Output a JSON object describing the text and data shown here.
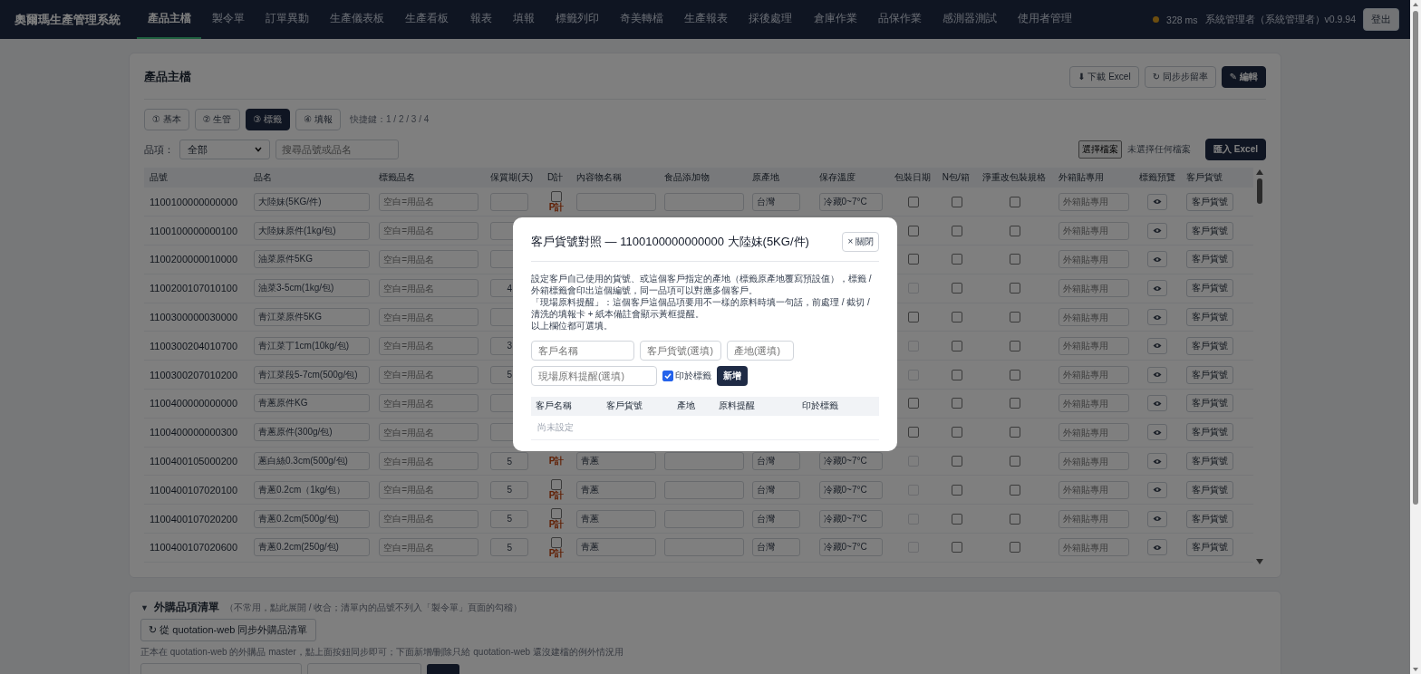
{
  "nav": {
    "brand": "奧爾瑪生產管理系統",
    "tabs": [
      {
        "label": "產品主檔",
        "selected": true
      },
      {
        "label": "製令單",
        "selected": false
      },
      {
        "label": "訂單異動",
        "selected": false
      },
      {
        "label": "生產儀表板",
        "selected": false
      },
      {
        "label": "生產看板",
        "selected": false
      },
      {
        "label": "報表",
        "selected": false
      },
      {
        "label": "填報",
        "selected": false
      },
      {
        "label": "標籤列印",
        "selected": false
      },
      {
        "label": "奇美轉檔",
        "selected": false
      },
      {
        "label": "生產報表",
        "selected": false
      },
      {
        "label": "採後處理",
        "selected": false
      },
      {
        "label": "倉庫作業",
        "selected": false
      },
      {
        "label": "品保作業",
        "selected": false
      },
      {
        "label": "感測器測試",
        "selected": false
      },
      {
        "label": "使用者管理",
        "selected": false
      }
    ],
    "latency": "328 ms",
    "user": "系統管理者（系統管理者）v0.9.94",
    "logout": "登出"
  },
  "card": {
    "title": "產品主檔",
    "actions": [
      {
        "label": "⬇ 下載 Excel",
        "kind": "outline"
      },
      {
        "label": "↻ 同步步留率",
        "kind": "outline"
      },
      {
        "label": "✎ 編輯",
        "kind": "primary"
      }
    ],
    "steps": [
      {
        "label": "① 基本",
        "selected": false
      },
      {
        "label": "② 生管",
        "selected": false
      },
      {
        "label": "③ 標籤",
        "selected": true
      },
      {
        "label": "④ 填報",
        "selected": false
      }
    ],
    "shortcut": "快捷鍵：1 / 2 / 3 / 4",
    "filter_label": "品項：",
    "filter_value": "全部",
    "search_placeholder": "搜尋品號或品名",
    "file_button": "選擇檔案",
    "file_status": "未選擇任何檔案",
    "import_button": "匯入 Excel"
  },
  "table": {
    "columns": [
      "品號",
      "品名",
      "標籤品名",
      "保質期(天)",
      "D計",
      "內容物名稱",
      "食品添加物",
      "原產地",
      "保存溫度",
      "包裝日期",
      "N包/箱",
      "淨重改包裝規格",
      "外箱貼專用",
      "標籤預覽",
      "客戶貨號"
    ],
    "rows": [
      {
        "code": "1100100000000000",
        "name": "大陸妹(5KG/件)",
        "label_placeholder": "空白=用品名",
        "shelf_days": "",
        "d_checked": false,
        "d_unit": "P計",
        "content": "",
        "additive": "",
        "origin": "台灣",
        "temp": "冷藏0~7°C",
        "date_checked": false,
        "date_disabled": false,
        "n_checked": false,
        "net_checked": false,
        "outer_placeholder": "外箱貼專用",
        "customer_button": "客戶貨號"
      },
      {
        "code": "1100100000000100",
        "name": "大陸妹原件(1kg/包)",
        "label_placeholder": "空白=用品名",
        "shelf_days": "",
        "date_checked": false,
        "date_disabled": false,
        "n_checked": false,
        "net_checked": false,
        "outer_placeholder": "外箱貼專用",
        "customer_button": "客戶貨號"
      },
      {
        "code": "1100200000010000",
        "name": "油菜原件5KG",
        "label_placeholder": "空白=用品名",
        "shelf_days": "",
        "date_checked": false,
        "date_disabled": false,
        "n_checked": false,
        "net_checked": false,
        "outer_placeholder": "外箱貼專用",
        "customer_button": "客戶貨號"
      },
      {
        "code": "1100200107010100",
        "name": "油菜3-5cm(1kg/包)",
        "label_placeholder": "空白=用品名",
        "shelf_days": "4",
        "date_checked": false,
        "date_disabled": true,
        "n_checked": false,
        "net_checked": false,
        "outer_placeholder": "外箱貼專用",
        "customer_button": "客戶貨號"
      },
      {
        "code": "1100300000030000",
        "name": "青江菜原件5KG",
        "label_placeholder": "空白=用品名",
        "shelf_days": "",
        "date_checked": false,
        "date_disabled": false,
        "n_checked": false,
        "net_checked": false,
        "outer_placeholder": "外箱貼專用",
        "customer_button": "客戶貨號"
      },
      {
        "code": "1100300204010700",
        "name": "青江菜丁1cm(10kg/包)",
        "label_placeholder": "空白=用品名",
        "shelf_days": "3",
        "date_checked": false,
        "date_disabled": true,
        "n_checked": false,
        "net_checked": false,
        "outer_placeholder": "外箱貼專用",
        "customer_button": "客戶貨號"
      },
      {
        "code": "1100300207010200",
        "name": "青江菜段5-7cm(500g/包)",
        "label_placeholder": "空白=用品名",
        "shelf_days": "5",
        "date_checked": false,
        "date_disabled": true,
        "n_checked": false,
        "net_checked": false,
        "outer_placeholder": "外箱貼專用",
        "customer_button": "客戶貨號"
      },
      {
        "code": "1100400000000000",
        "name": "青蔥原件KG",
        "label_placeholder": "空白=用品名",
        "shelf_days": "",
        "date_checked": false,
        "date_disabled": false,
        "n_checked": false,
        "net_checked": false,
        "outer_placeholder": "外箱貼專用",
        "customer_button": "客戶貨號"
      },
      {
        "code": "1100400000000300",
        "name": "青蔥原件(300g/包)",
        "label_placeholder": "空白=用品名",
        "shelf_days": "",
        "date_checked": false,
        "date_disabled": false,
        "n_checked": false,
        "net_checked": false,
        "outer_placeholder": "外箱貼專用",
        "customer_button": "客戶貨號"
      },
      {
        "code": "1100400105000200",
        "name": "蔥白絲0.3cm(500g/包)",
        "label_placeholder": "空白=用品名",
        "shelf_days": "5",
        "d_unit": "P計",
        "content": "青蔥",
        "additive": "",
        "origin": "台灣",
        "temp": "冷藏0~7°C",
        "date_checked": false,
        "date_disabled": true,
        "n_checked": false,
        "net_checked": false,
        "outer_placeholder": "外箱貼專用",
        "customer_button": "客戶貨號"
      },
      {
        "code": "1100400107020100",
        "name": "青蔥0.2cm（1kg/包）",
        "label_placeholder": "空白=用品名",
        "shelf_days": "5",
        "d_checked": false,
        "d_unit": "P計",
        "content": "青蔥",
        "additive": "",
        "origin": "台灣",
        "temp": "冷藏0~7°C",
        "date_checked": false,
        "date_disabled": true,
        "n_checked": false,
        "net_checked": false,
        "outer_placeholder": "外箱貼專用",
        "customer_button": "客戶貨號"
      },
      {
        "code": "1100400107020200",
        "name": "青蔥0.2cm(500g/包)",
        "label_placeholder": "空白=用品名",
        "shelf_days": "5",
        "d_checked": false,
        "d_unit": "P計",
        "content": "青蔥",
        "additive": "",
        "origin": "台灣",
        "temp": "冷藏0~7°C",
        "date_checked": false,
        "date_disabled": true,
        "n_checked": false,
        "net_checked": false,
        "outer_placeholder": "外箱貼專用",
        "customer_button": "客戶貨號"
      },
      {
        "code": "1100400107020600",
        "name": "青蔥0.2cm(250g/包)",
        "label_placeholder": "空白=用品名",
        "shelf_days": "5",
        "d_checked": false,
        "d_unit": "P計",
        "content": "青蔥",
        "additive": "",
        "origin": "台灣",
        "temp": "冷藏0~7°C",
        "date_checked": false,
        "date_disabled": true,
        "n_checked": false,
        "net_checked": false,
        "outer_placeholder": "外箱貼專用",
        "customer_button": "客戶貨號"
      }
    ]
  },
  "purchased": {
    "expanded": true,
    "toggle": "▼",
    "title": "外購品項清單",
    "note": "（不常用，點此展開 / 收合；清單內的品號不列入「製令單」頁面的勾稽）",
    "sync_button": "↻ 從 quotation-web 同步外購品清單",
    "info": "正本在 quotation-web 的外購品 master，點上面按鈕同步即可；下面新增/刪除只給 quotation-web 還沒建檔的例外情況用"
  },
  "modal": {
    "title": "客戶貨號對照 — 1100100000000000 大陸妹(5KG/件)",
    "close": "× 關閉",
    "description": [
      "設定客戶自己使用的貨號、或這個客戶指定的產地（標籤原產地覆寫預設值），標籤 / 外箱標籤會印出這個編號，同一品項可以對應多個客戶。",
      "「現場原料提醒」：這個客戶這個品項要用不一樣的原料時填一句話，前處理 / 截切 / 清洗的填報卡 + 紙本備註會顯示黃框提醒。",
      "以上欄位都可選填。"
    ],
    "fields": [
      {
        "placeholder": "客戶名稱"
      },
      {
        "placeholder": "客戶貨號(選填)"
      },
      {
        "placeholder": "產地(選填)"
      },
      {
        "placeholder": "現場原料提醒(選填)"
      }
    ],
    "print_checkbox": {
      "label": "印於標籤",
      "checked": true
    },
    "add_button": "新增",
    "columns": [
      "客戶名稱",
      "客戶貨號",
      "產地",
      "原料提醒",
      "印於標籤"
    ],
    "empty": "尚未設定"
  }
}
